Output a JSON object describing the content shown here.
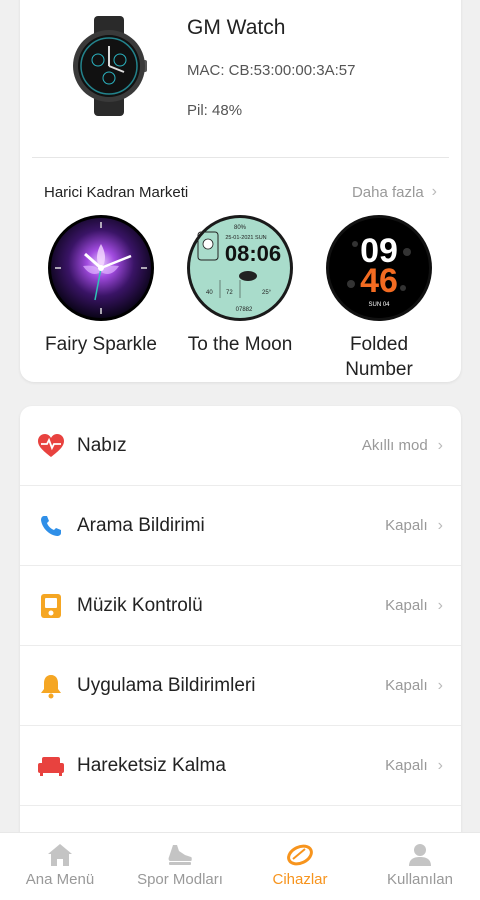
{
  "device": {
    "name": "GM Watch",
    "mac": "MAC: CB:53:00:00:3A:57",
    "battery": "Pil: 48%"
  },
  "market": {
    "title": "Harici Kadran Marketi",
    "more": "Daha fazla",
    "faces": [
      {
        "name": "Fairy Sparkle"
      },
      {
        "name": "To the Moon",
        "time": "08:06",
        "date": "25-01-2021 SUN",
        "battery": "80%",
        "steps": "07882",
        "hr": "72",
        "temp": "25°",
        "weather": "40"
      },
      {
        "name": "Folded Number",
        "hour": "09",
        "minute": "46",
        "day": "SUN 04"
      }
    ]
  },
  "settings": {
    "items": [
      {
        "label": "Nabız",
        "value": "Akıllı mod",
        "icon": "heart-rate-icon"
      },
      {
        "label": "Arama Bildirimi",
        "value": "Kapalı",
        "icon": "phone-icon"
      },
      {
        "label": "Müzik Kontrolü",
        "value": "Kapalı",
        "icon": "music-player-icon"
      },
      {
        "label": "Uygulama Bildirimleri",
        "value": "Kapalı",
        "icon": "bell-icon"
      },
      {
        "label": "Hareketsiz Kalma",
        "value": "Kapalı",
        "icon": "sofa-icon"
      }
    ]
  },
  "nav": {
    "items": [
      {
        "label": "Ana Menü",
        "icon": "home-icon"
      },
      {
        "label": "Spor Modları",
        "icon": "running-shoe-icon"
      },
      {
        "label": "Cihazlar",
        "icon": "watch-band-icon",
        "active": true
      },
      {
        "label": "Kullanılan",
        "icon": "user-icon"
      }
    ]
  },
  "colors": {
    "accent": "#f7941d",
    "heart": "#e8423f",
    "phone": "#2f8fe8",
    "music": "#f5a623",
    "bell": "#f5a623",
    "sofa": "#e8423f",
    "nav_inactive": "#c4c4c4"
  }
}
